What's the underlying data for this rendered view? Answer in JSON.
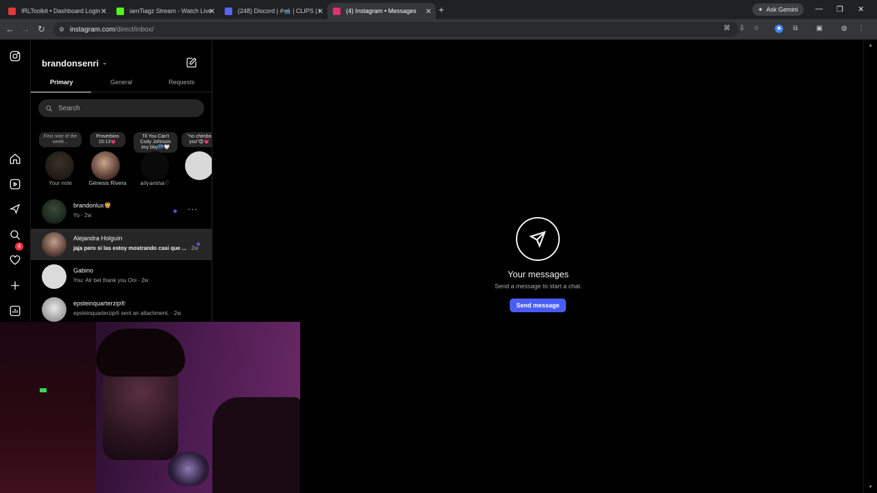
{
  "browser": {
    "tabs": [
      {
        "title": "IRLToolkit • Dashboard Login",
        "favicon_color": "#e03a3a"
      },
      {
        "title": "iamTiagz Stream - Watch Live o",
        "favicon_color": "#53fc18"
      },
      {
        "title": "(248) Discord | #📹 | CLIPS | Ob",
        "favicon_color": "#5865f2"
      },
      {
        "title": "(4) Instagram • Messages",
        "favicon_color": "#e1306c"
      }
    ],
    "ask_gemini": "Ask Gemini",
    "url_host": "instagram.com",
    "url_path": "/direct/inbox/"
  },
  "rail": {
    "notification_count": "4"
  },
  "inbox": {
    "username": "brandonsenri",
    "tabs": [
      "Primary",
      "General",
      "Requests"
    ],
    "search_placeholder": "Search",
    "notes": [
      {
        "note": "First note of the week...",
        "name": "Your note"
      },
      {
        "note": "Proverbios 15:13💗",
        "name": "Génesis Rivera"
      },
      {
        "note": "Til You Can't Cody Johnson imy bby🌃🤍",
        "name": "𝕒𝕚𝕪𝕒𝕟𝕟𝕒♡"
      },
      {
        "note": "\"no chimbo you\"😋💗",
        "name": ""
      }
    ],
    "threads": [
      {
        "name": "brandonlux🦁",
        "message": "Yo",
        "time": "2w",
        "unread": false
      },
      {
        "name": "Alejandra Holguín",
        "message": "jaja pero si las estoy mostrando casi que ...",
        "time": "2w",
        "unread": true
      },
      {
        "name": "Gabino",
        "message": "You: Alr bet thank you Oni",
        "time": "2w",
        "unread": false
      },
      {
        "name": "epsteinquarterzip®",
        "message": "epsteinquarterzip® sent an attachment.",
        "time": "2w",
        "unread": false
      }
    ]
  },
  "main": {
    "title": "Your messages",
    "subtitle": "Send a message to start a chat.",
    "button": "Send message"
  }
}
